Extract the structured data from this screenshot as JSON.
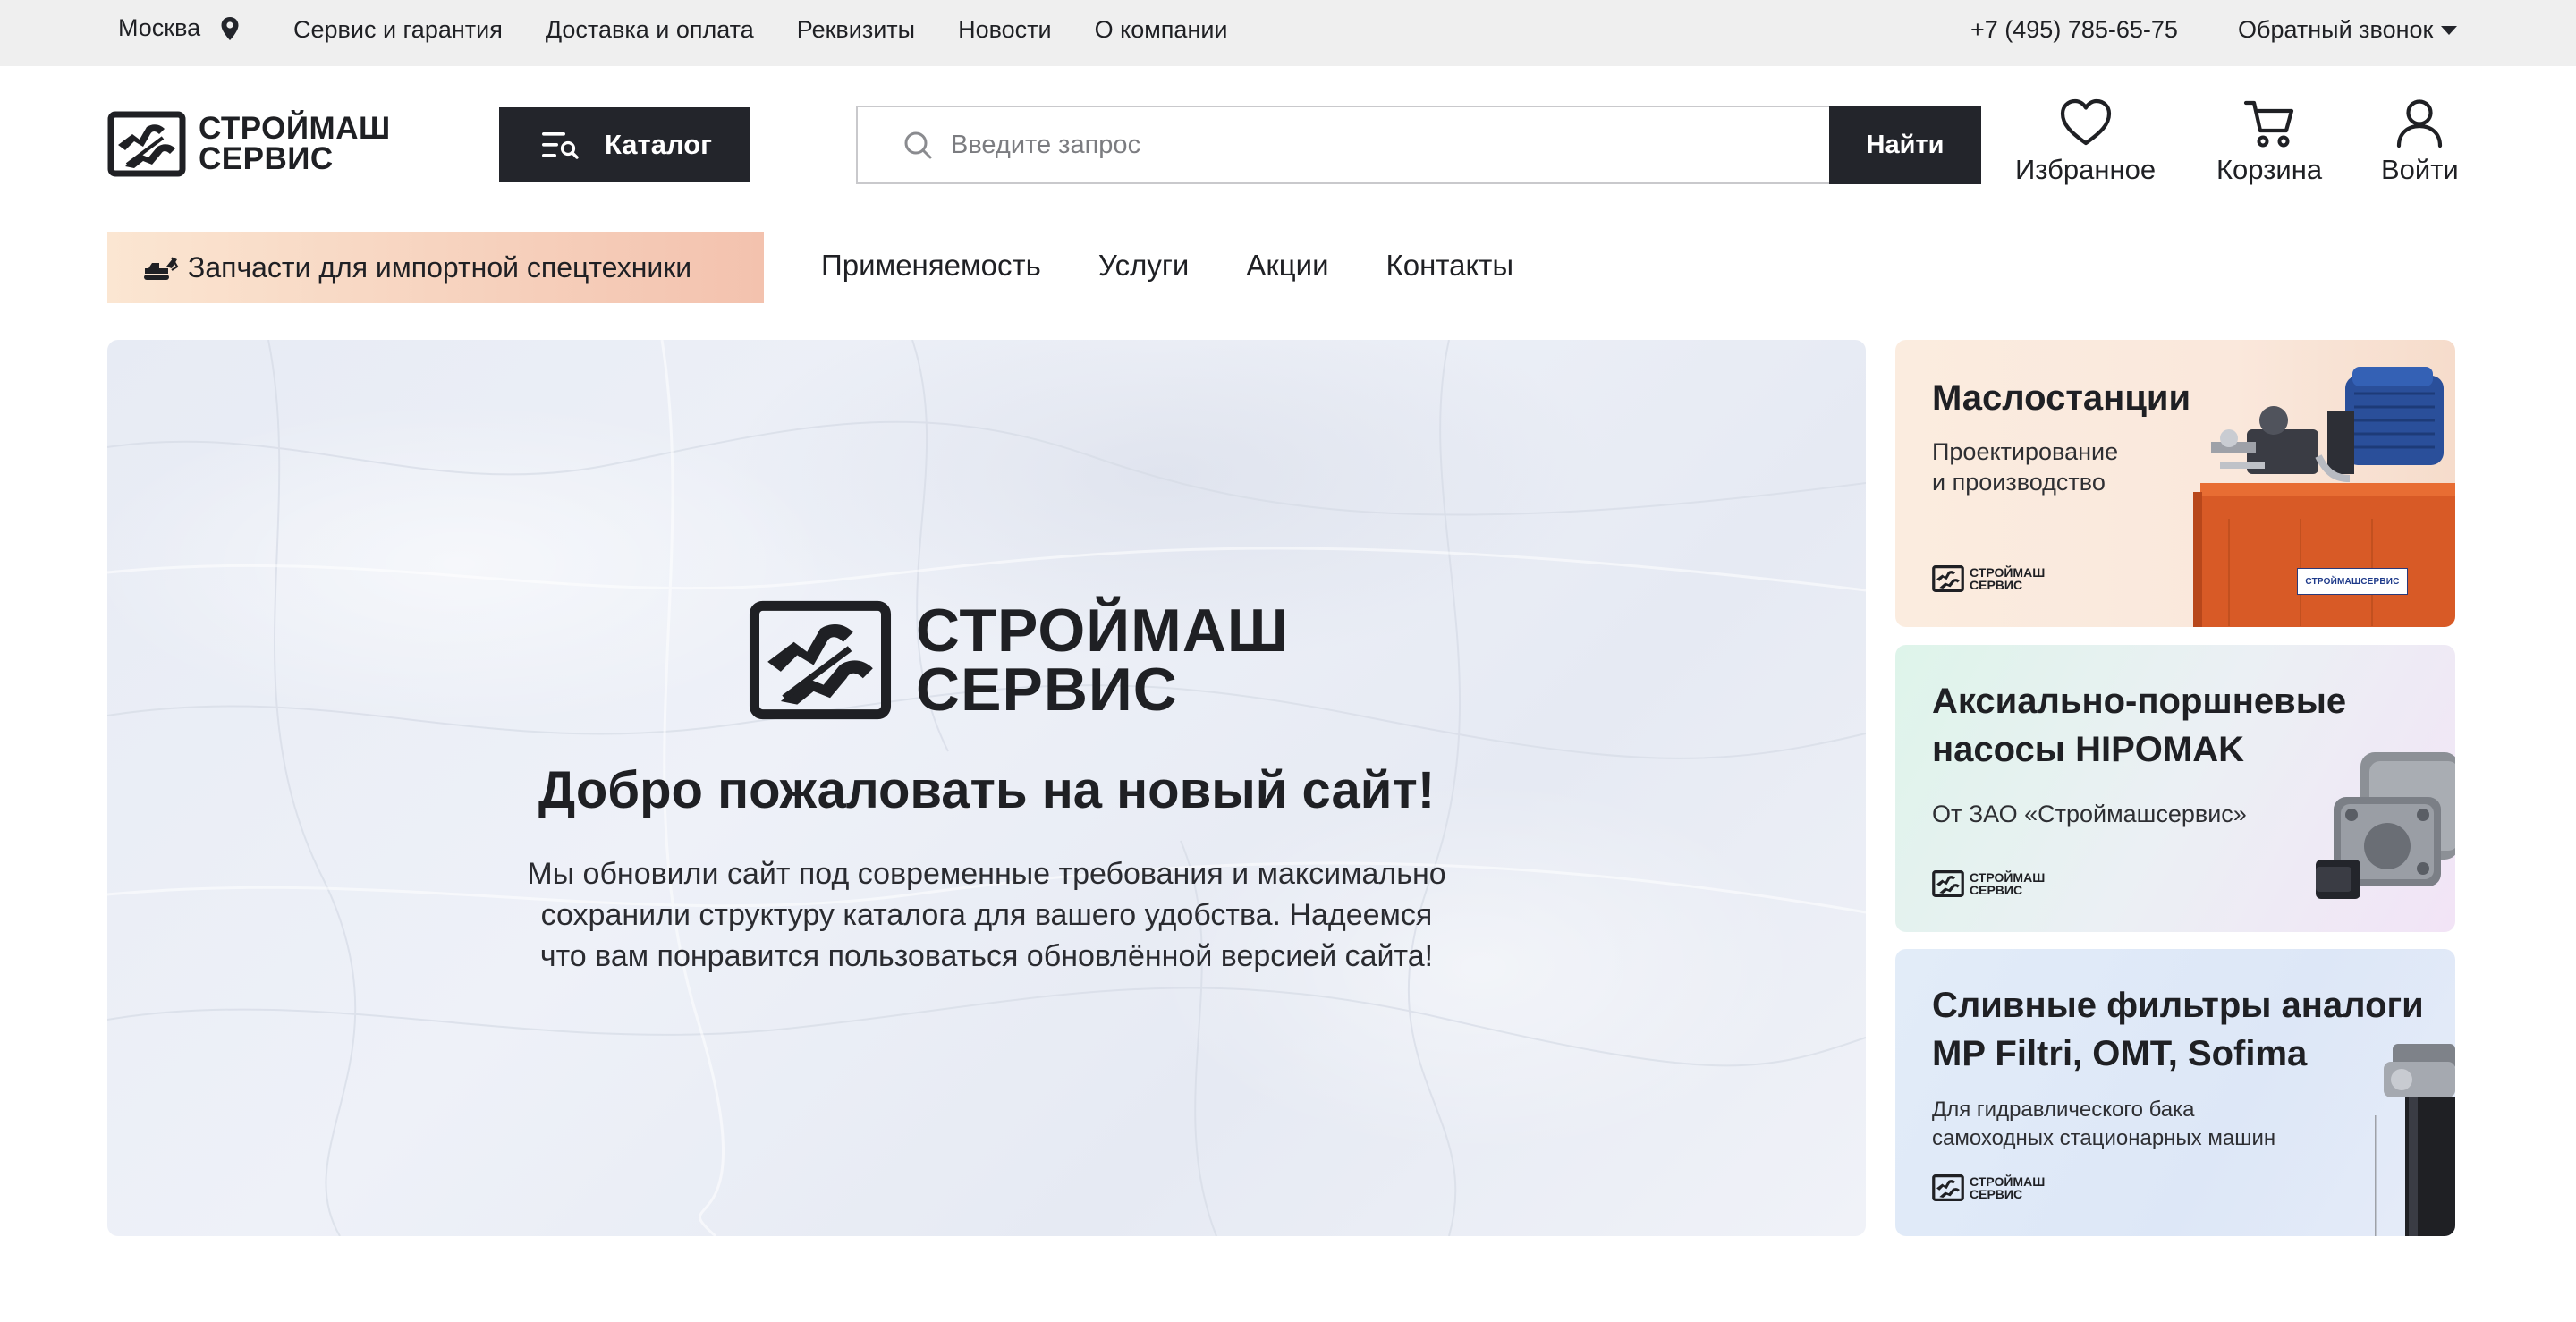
{
  "topbar": {
    "city": "Москва",
    "links": [
      "Сервис и гарантия",
      "Доставка и оплата",
      "Реквизиты",
      "Новости",
      "О компании"
    ],
    "phone": "+7 (495) 785-65-75",
    "callback": "Обратный звонок"
  },
  "header": {
    "logo_line1": "СТРОЙМАШ",
    "logo_line2": "СЕРВИС",
    "catalog_label": "Каталог",
    "search_placeholder": "Введите запрос",
    "search_button": "Найти",
    "favorites": "Избранное",
    "cart": "Корзина",
    "login": "Войти"
  },
  "nav": {
    "promo_tab": "Запчасти для импортной спецтехники",
    "links": [
      "Применяемость",
      "Услуги",
      "Акции",
      "Контакты"
    ]
  },
  "hero": {
    "logo_line1": "СТРОЙМАШ",
    "logo_line2": "СЕРВИС",
    "title": "Добро пожаловать на новый сайт!",
    "text": "Мы обновили сайт под современные требования и максимально\nсохранили структуру каталога для вашего удобства. Надеемся\nчто вам понравится пользоваться обновлённой версией сайта!"
  },
  "cards": [
    {
      "title": "Маслостанции",
      "subtitle": "Проектирование\nи производство",
      "logo_line1": "СТРОЙМАШ",
      "logo_line2": "СЕРВИС",
      "sticker_text": "СТРОЙМАШСЕРВИС"
    },
    {
      "title": "Аксиально-поршневые\nнасосы HIPOMAK",
      "subtitle": "От ЗАО «Строймашсервис»",
      "logo_line1": "СТРОЙМАШ",
      "logo_line2": "СЕРВИС"
    },
    {
      "title": "Сливные фильтры аналоги\nMP Filtri, OMT, Sofima",
      "subtitle": "Для гидравлического бака\nсамоходных стационарных машин",
      "logo_line1": "СТРОЙМАШ",
      "logo_line2": "СЕРВИС"
    }
  ],
  "colors": {
    "dark": "#23252b",
    "topbar_bg": "#efefef",
    "promo_from": "#fbe6d2",
    "promo_to": "#f3c2ae",
    "hero_bg": "#e9edf5"
  }
}
